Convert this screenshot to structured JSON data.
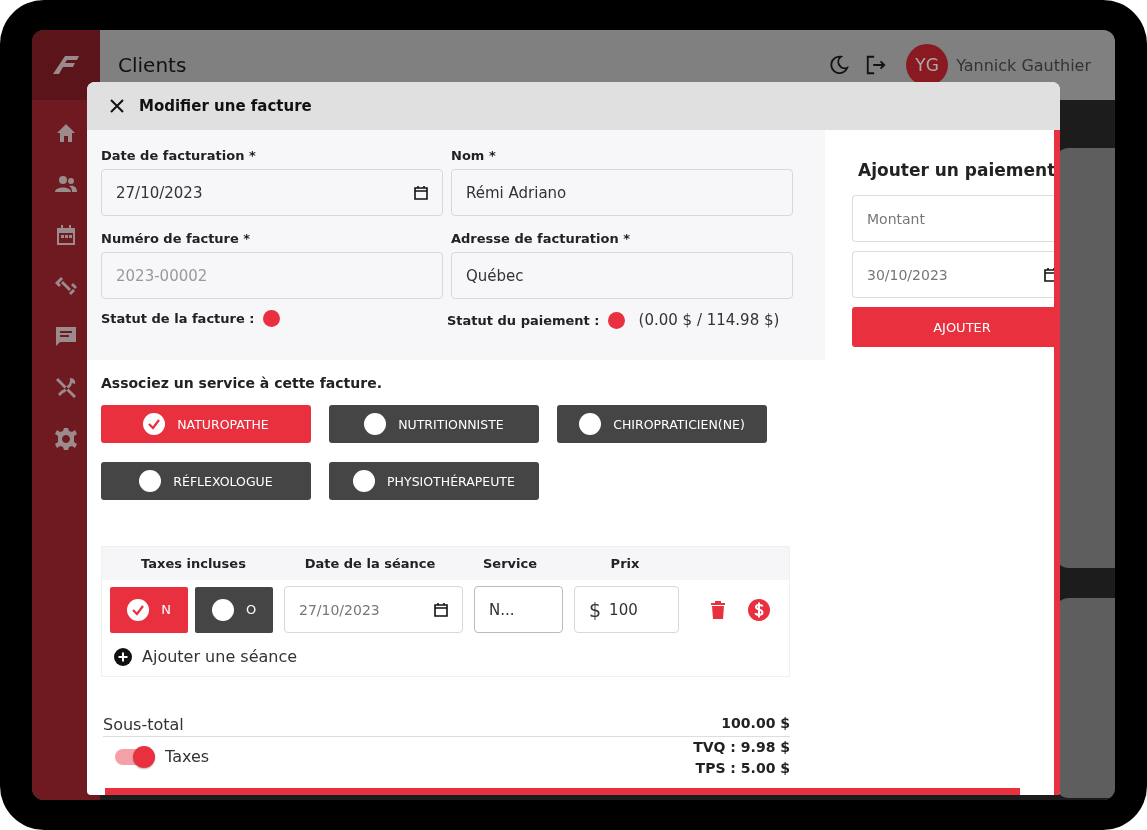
{
  "header": {
    "title": "Clients",
    "user": {
      "initials": "YG",
      "name": "Yannick Gauthier"
    }
  },
  "modal": {
    "title": "Modifier une facture",
    "fields": [
      {
        "label": "Date de facturation *",
        "value": "27/10/2023",
        "kind": "date",
        "disabled": false
      },
      {
        "label": "Nom *",
        "value": "Rémi Adriano",
        "kind": "text",
        "disabled": false
      },
      {
        "label": "Numéro de facture *",
        "value": "2023-00002",
        "kind": "text",
        "disabled": true
      },
      {
        "label": "Adresse de facturation *",
        "value": "Québec",
        "kind": "text",
        "disabled": false
      }
    ],
    "invoice_status": {
      "label": "Statut de la facture :",
      "color": "#e8303f"
    },
    "payment_status": {
      "label": "Statut du paiement :",
      "color": "#e8303f",
      "amount": "(0.00 $ / 114.98 $)"
    },
    "services_prompt": "Associez un service à cette facture.",
    "services": [
      {
        "label": "NATUROPATHE",
        "selected": true
      },
      {
        "label": "NUTRITIONNISTE",
        "selected": false
      },
      {
        "label": "CHIROPRATICIEN(NE)",
        "selected": false
      },
      {
        "label": "RÉFLEXOLOGUE",
        "selected": false
      },
      {
        "label": "PHYSIOTHÉRAPEUTE",
        "selected": false
      }
    ],
    "sessions": {
      "columns": [
        "Taxes incluses",
        "Date de la séance",
        "Service",
        "Prix"
      ],
      "rows": [
        {
          "tax_options": [
            {
              "label": "N",
              "selected": true
            },
            {
              "label": "O",
              "selected": false
            }
          ],
          "date": "27/10/2023",
          "service": "N...",
          "currency": "$",
          "price": "100"
        }
      ],
      "add_label": "Ajouter une séance"
    },
    "totals": {
      "subtotal_label": "Sous-total",
      "subtotal_value": "100.00 $",
      "taxes_toggle": {
        "label": "Taxes",
        "on": true
      },
      "tax_lines": [
        "TVQ : 9.98 $",
        "TPS : 5.00 $"
      ]
    },
    "payment": {
      "title": "Ajouter un paiement",
      "amount_placeholder": "Montant",
      "date": "30/10/2023",
      "button": "AJOUTER"
    }
  }
}
